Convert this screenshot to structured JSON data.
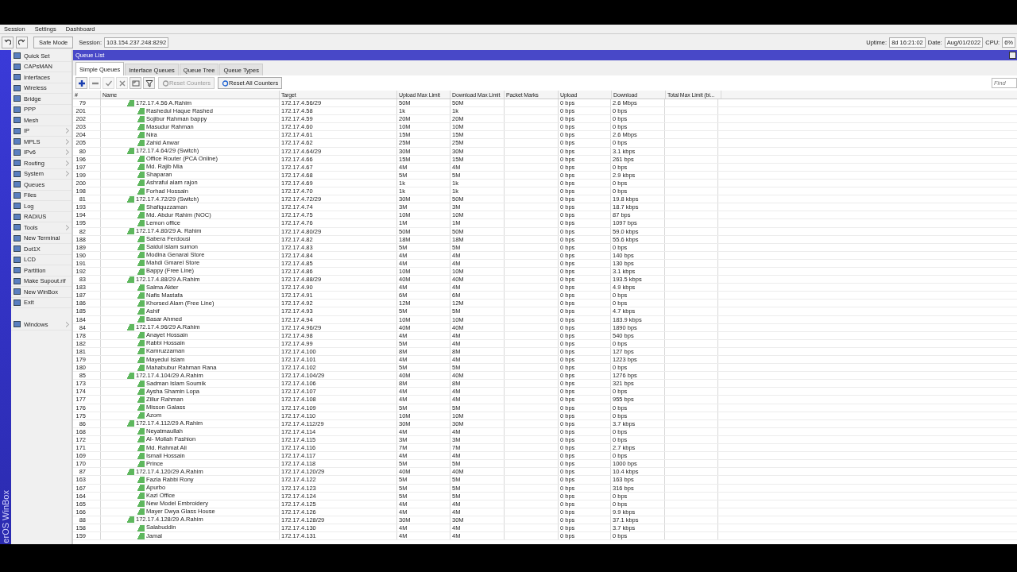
{
  "menu": [
    "Session",
    "Settings",
    "Dashboard"
  ],
  "toolbar": {
    "safe_mode": "Safe Mode",
    "session_label": "Session:",
    "session": "103.154.237.248:8292",
    "status": [
      {
        "label": "Uptime:",
        "value": "8d 16:21:02"
      },
      {
        "label": "Date:",
        "value": "Aug/01/2022"
      },
      {
        "label": "CPU:",
        "value": "6%"
      }
    ]
  },
  "brand": "erOS WinBox",
  "sidebar": {
    "items": [
      {
        "label": "Quick Set",
        "submenu": false
      },
      {
        "label": "CAPsMAN",
        "submenu": false
      },
      {
        "label": "Interfaces",
        "submenu": false
      },
      {
        "label": "Wireless",
        "submenu": false
      },
      {
        "label": "Bridge",
        "submenu": false
      },
      {
        "label": "PPP",
        "submenu": false
      },
      {
        "label": "Mesh",
        "submenu": false
      },
      {
        "label": "IP",
        "submenu": true
      },
      {
        "label": "MPLS",
        "submenu": true
      },
      {
        "label": "IPv6",
        "submenu": true
      },
      {
        "label": "Routing",
        "submenu": true
      },
      {
        "label": "System",
        "submenu": true
      },
      {
        "label": "Queues",
        "submenu": false
      },
      {
        "label": "Files",
        "submenu": false
      },
      {
        "label": "Log",
        "submenu": false
      },
      {
        "label": "RADIUS",
        "submenu": false
      },
      {
        "label": "Tools",
        "submenu": true
      },
      {
        "label": "New Terminal",
        "submenu": false
      },
      {
        "label": "Dot1X",
        "submenu": false
      },
      {
        "label": "LCD",
        "submenu": false
      },
      {
        "label": "Partition",
        "submenu": false
      },
      {
        "label": "Make Supout.rif",
        "submenu": false
      },
      {
        "label": "New WinBox",
        "submenu": false
      },
      {
        "label": "Exit",
        "submenu": false
      }
    ],
    "bottom_items": [
      {
        "label": "Windows",
        "submenu": true
      }
    ]
  },
  "window": {
    "title": "Queue List",
    "tabs": [
      {
        "label": "Simple Queues",
        "selected": true
      },
      {
        "label": "Interface Queues",
        "selected": false
      },
      {
        "label": "Queue Tree",
        "selected": false
      },
      {
        "label": "Queue Types",
        "selected": false
      }
    ],
    "tools": [
      {
        "kind": "add",
        "disabled": false
      },
      {
        "kind": "remove",
        "disabled": true
      },
      {
        "kind": "enable",
        "disabled": true
      },
      {
        "kind": "disable",
        "disabled": true
      },
      {
        "kind": "comment",
        "disabled": false
      },
      {
        "kind": "filter",
        "disabled": false
      }
    ],
    "actions": [
      {
        "label": "Reset Counters",
        "disabled": true
      },
      {
        "label": "Reset All Counters",
        "disabled": false
      }
    ],
    "search": {
      "placeholder": "Find"
    },
    "table": {
      "columns": [
        "#",
        "Name",
        "Target",
        "Upload Max Limit",
        "Download Max Limit",
        "Packet Marks",
        "Upload",
        "Download",
        "Total Max Limit (bi..."
      ],
      "rows": [
        {
          "number": "79",
          "name": "172.17.4.56 A.Rahim",
          "target": "172.17.4.56/29",
          "upload_max_limit": "50M",
          "download_max_limit": "50M",
          "upload": "0 bps",
          "download": "2.6 Mbps",
          "children": [
            {
              "number": "201",
              "name": "Rashedul Haque Rashed",
              "target": "172.17.4.58",
              "upload_max_limit": "1k",
              "download_max_limit": "1k",
              "upload": "0 bps",
              "download": "0 bps"
            },
            {
              "number": "202",
              "name": "Sojibur Rahman bappy",
              "target": "172.17.4.59",
              "upload_max_limit": "20M",
              "download_max_limit": "20M",
              "upload": "0 bps",
              "download": "0 bps"
            },
            {
              "number": "203",
              "name": "Masudur Rahman",
              "target": "172.17.4.60",
              "upload_max_limit": "10M",
              "download_max_limit": "10M",
              "upload": "0 bps",
              "download": "0 bps"
            },
            {
              "number": "204",
              "name": "Nira",
              "target": "172.17.4.61",
              "upload_max_limit": "15M",
              "download_max_limit": "15M",
              "upload": "0 bps",
              "download": "2.6 Mbps"
            },
            {
              "number": "205",
              "name": "Zahid Anwar",
              "target": "172.17.4.62",
              "upload_max_limit": "25M",
              "download_max_limit": "25M",
              "upload": "0 bps",
              "download": "0 bps"
            }
          ]
        },
        {
          "number": "80",
          "name": "172.17.4.64/29 (Switch)",
          "target": "172.17.4.64/29",
          "upload_max_limit": "30M",
          "download_max_limit": "30M",
          "upload": "0 bps",
          "download": "3.1 kbps",
          "children": [
            {
              "number": "196",
              "name": "Office Router (PCA Online)",
              "target": "172.17.4.66",
              "upload_max_limit": "15M",
              "download_max_limit": "15M",
              "upload": "0 bps",
              "download": "261 bps"
            },
            {
              "number": "197",
              "name": "Md. Rajib Mia",
              "target": "172.17.4.67",
              "upload_max_limit": "4M",
              "download_max_limit": "4M",
              "upload": "0 bps",
              "download": "0 bps"
            },
            {
              "number": "199",
              "name": "Shaparan",
              "target": "172.17.4.68",
              "upload_max_limit": "5M",
              "download_max_limit": "5M",
              "upload": "0 bps",
              "download": "2.9 kbps"
            },
            {
              "number": "200",
              "name": "Ashraful alam rajon",
              "target": "172.17.4.69",
              "upload_max_limit": "1k",
              "download_max_limit": "1k",
              "upload": "0 bps",
              "download": "0 bps"
            },
            {
              "number": "198",
              "name": "Forhad Hossain",
              "target": "172.17.4.70",
              "upload_max_limit": "1k",
              "download_max_limit": "1k",
              "upload": "0 bps",
              "download": "0 bps"
            }
          ]
        },
        {
          "number": "81",
          "name": "172.17.4.72/29 (Switch)",
          "target": "172.17.4.72/29",
          "upload_max_limit": "30M",
          "download_max_limit": "50M",
          "upload": "0 bps",
          "download": "19.8 kbps",
          "children": [
            {
              "number": "193",
              "name": "Shafiquzzaman",
              "target": "172.17.4.74",
              "upload_max_limit": "3M",
              "download_max_limit": "3M",
              "upload": "0 bps",
              "download": "18.7 kbps"
            },
            {
              "number": "194",
              "name": "Md. Abdur Rahim (NOC)",
              "target": "172.17.4.75",
              "upload_max_limit": "10M",
              "download_max_limit": "10M",
              "upload": "0 bps",
              "download": "87 bps"
            },
            {
              "number": "195",
              "name": "Lemon office",
              "target": "172.17.4.76",
              "upload_max_limit": "1M",
              "download_max_limit": "1M",
              "upload": "0 bps",
              "download": "1097 bps"
            }
          ]
        },
        {
          "number": "82",
          "name": "172.17.4.80/29 A. Rahim",
          "target": "172.17.4.80/29",
          "upload_max_limit": "50M",
          "download_max_limit": "50M",
          "upload": "0 bps",
          "download": "59.0 kbps",
          "children": [
            {
              "number": "188",
              "name": "Sabera Ferdousi",
              "target": "172.17.4.82",
              "upload_max_limit": "18M",
              "download_max_limit": "18M",
              "upload": "0 bps",
              "download": "55.6 kbps"
            },
            {
              "number": "189",
              "name": "Saidul islam sumon",
              "target": "172.17.4.83",
              "upload_max_limit": "5M",
              "download_max_limit": "5M",
              "upload": "0 bps",
              "download": "0 bps"
            },
            {
              "number": "190",
              "name": "Modina Genaral Store",
              "target": "172.17.4.84",
              "upload_max_limit": "4M",
              "download_max_limit": "4M",
              "upload": "0 bps",
              "download": "140 bps"
            },
            {
              "number": "191",
              "name": "Mahdi Gmarel Store",
              "target": "172.17.4.85",
              "upload_max_limit": "4M",
              "download_max_limit": "4M",
              "upload": "0 bps",
              "download": "130 bps"
            },
            {
              "number": "192",
              "name": "Bappy (Free Line)",
              "target": "172.17.4.86",
              "upload_max_limit": "10M",
              "download_max_limit": "10M",
              "upload": "0 bps",
              "download": "3.1 kbps"
            }
          ]
        },
        {
          "number": "83",
          "name": "172.17.4.88/29 A.Rahim",
          "target": "172.17.4.88/29",
          "upload_max_limit": "40M",
          "download_max_limit": "40M",
          "upload": "0 bps",
          "download": "193.5 kbps",
          "children": [
            {
              "number": "183",
              "name": "Salma Akter",
              "target": "172.17.4.90",
              "upload_max_limit": "4M",
              "download_max_limit": "4M",
              "upload": "0 bps",
              "download": "4.9 kbps"
            },
            {
              "number": "187",
              "name": "Nafis Mastafa",
              "target": "172.17.4.91",
              "upload_max_limit": "6M",
              "download_max_limit": "6M",
              "upload": "0 bps",
              "download": "0 bps"
            },
            {
              "number": "186",
              "name": "Khorsed Alam (Free Line)",
              "target": "172.17.4.92",
              "upload_max_limit": "12M",
              "download_max_limit": "12M",
              "upload": "0 bps",
              "download": "0 bps"
            },
            {
              "number": "185",
              "name": "Ashif",
              "target": "172.17.4.93",
              "upload_max_limit": "5M",
              "download_max_limit": "5M",
              "upload": "0 bps",
              "download": "4.7 kbps"
            },
            {
              "number": "184",
              "name": "Basar Ahmed",
              "target": "172.17.4.94",
              "upload_max_limit": "10M",
              "download_max_limit": "10M",
              "upload": "0 bps",
              "download": "183.9 kbps"
            }
          ]
        },
        {
          "number": "84",
          "name": "172.17.4.96/29 A.Rahim",
          "target": "172.17.4.96/29",
          "upload_max_limit": "40M",
          "download_max_limit": "40M",
          "upload": "0 bps",
          "download": "1890 bps",
          "children": [
            {
              "number": "178",
              "name": "Anayet Hossain",
              "target": "172.17.4.98",
              "upload_max_limit": "4M",
              "download_max_limit": "4M",
              "upload": "0 bps",
              "download": "540 bps"
            },
            {
              "number": "182",
              "name": "Rabbi Hossain",
              "target": "172.17.4.99",
              "upload_max_limit": "5M",
              "download_max_limit": "4M",
              "upload": "0 bps",
              "download": "0 bps"
            },
            {
              "number": "181",
              "name": "Kamruzzaman",
              "target": "172.17.4.100",
              "upload_max_limit": "8M",
              "download_max_limit": "8M",
              "upload": "0 bps",
              "download": "127 bps"
            },
            {
              "number": "179",
              "name": "Mayedul Islam",
              "target": "172.17.4.101",
              "upload_max_limit": "4M",
              "download_max_limit": "4M",
              "upload": "0 bps",
              "download": "1223 bps"
            },
            {
              "number": "180",
              "name": "Mahabubur Rahman Rana",
              "target": "172.17.4.102",
              "upload_max_limit": "5M",
              "download_max_limit": "5M",
              "upload": "0 bps",
              "download": "0 bps"
            }
          ]
        },
        {
          "number": "85",
          "name": "172.17.4.104/29 A.Rahim",
          "target": "172.17.4.104/29",
          "upload_max_limit": "40M",
          "download_max_limit": "40M",
          "upload": "0 bps",
          "download": "1276 bps",
          "children": [
            {
              "number": "173",
              "name": "Sadman Islam Soumik",
              "target": "172.17.4.106",
              "upload_max_limit": "8M",
              "download_max_limit": "8M",
              "upload": "0 bps",
              "download": "321 bps"
            },
            {
              "number": "174",
              "name": "Aysha Shamin Lopa",
              "target": "172.17.4.107",
              "upload_max_limit": "4M",
              "download_max_limit": "4M",
              "upload": "0 bps",
              "download": "0 bps"
            },
            {
              "number": "177",
              "name": "Zillur Rahman",
              "target": "172.17.4.108",
              "upload_max_limit": "4M",
              "download_max_limit": "4M",
              "upload": "0 bps",
              "download": "955 bps"
            },
            {
              "number": "176",
              "name": "Misson Galass",
              "target": "172.17.4.109",
              "upload_max_limit": "5M",
              "download_max_limit": "5M",
              "upload": "0 bps",
              "download": "0 bps"
            },
            {
              "number": "175",
              "name": "Azom",
              "target": "172.17.4.110",
              "upload_max_limit": "10M",
              "download_max_limit": "10M",
              "upload": "0 bps",
              "download": "0 bps"
            }
          ]
        },
        {
          "number": "86",
          "name": "172.17.4.112/29 A.Rahim",
          "target": "172.17.4.112/29",
          "upload_max_limit": "30M",
          "download_max_limit": "30M",
          "upload": "0 bps",
          "download": "3.7 kbps",
          "children": [
            {
              "number": "168",
              "name": "Neyatmaullah",
              "target": "172.17.4.114",
              "upload_max_limit": "4M",
              "download_max_limit": "4M",
              "upload": "0 bps",
              "download": "0 bps"
            },
            {
              "number": "172",
              "name": "Al- Mollah Fashion",
              "target": "172.17.4.115",
              "upload_max_limit": "3M",
              "download_max_limit": "3M",
              "upload": "0 bps",
              "download": "0 bps"
            },
            {
              "number": "171",
              "name": "Md. Rahmat Ali",
              "target": "172.17.4.116",
              "upload_max_limit": "7M",
              "download_max_limit": "7M",
              "upload": "0 bps",
              "download": "2.7 kbps"
            },
            {
              "number": "169",
              "name": "Ismail Hossain",
              "target": "172.17.4.117",
              "upload_max_limit": "4M",
              "download_max_limit": "4M",
              "upload": "0 bps",
              "download": "0 bps"
            },
            {
              "number": "170",
              "name": "Prince",
              "target": "172.17.4.118",
              "upload_max_limit": "5M",
              "download_max_limit": "5M",
              "upload": "0 bps",
              "download": "1000 bps"
            }
          ]
        },
        {
          "number": "87",
          "name": "172.17.4.120/29 A.Rahim",
          "target": "172.17.4.120/29",
          "upload_max_limit": "40M",
          "download_max_limit": "40M",
          "upload": "0 bps",
          "download": "10.4 kbps",
          "children": [
            {
              "number": "163",
              "name": "Fazla Rabbi Rony",
              "target": "172.17.4.122",
              "upload_max_limit": "5M",
              "download_max_limit": "5M",
              "upload": "0 bps",
              "download": "163 bps"
            },
            {
              "number": "167",
              "name": "Apurbo",
              "target": "172.17.4.123",
              "upload_max_limit": "5M",
              "download_max_limit": "5M",
              "upload": "0 bps",
              "download": "316 bps"
            },
            {
              "number": "164",
              "name": "Kazi Office",
              "target": "172.17.4.124",
              "upload_max_limit": "5M",
              "download_max_limit": "5M",
              "upload": "0 bps",
              "download": "0 bps"
            },
            {
              "number": "165",
              "name": "New Model Embroidery",
              "target": "172.17.4.125",
              "upload_max_limit": "4M",
              "download_max_limit": "4M",
              "upload": "0 bps",
              "download": "0 bps"
            },
            {
              "number": "166",
              "name": "Mayer Dwya Glass House",
              "target": "172.17.4.126",
              "upload_max_limit": "4M",
              "download_max_limit": "4M",
              "upload": "0 bps",
              "download": "9.9 kbps"
            }
          ]
        },
        {
          "number": "88",
          "name": "172.17.4.128/29 A.Rahim",
          "target": "172.17.4.128/29",
          "upload_max_limit": "30M",
          "download_max_limit": "30M",
          "upload": "0 bps",
          "download": "37.1 kbps",
          "children": [
            {
              "number": "158",
              "name": "Salabuddin",
              "target": "172.17.4.130",
              "upload_max_limit": "4M",
              "download_max_limit": "4M",
              "upload": "0 bps",
              "download": "3.7 kbps"
            },
            {
              "number": "159",
              "name": "Jamal",
              "target": "172.17.4.131",
              "upload_max_limit": "4M",
              "download_max_limit": "4M",
              "upload": "0 bps",
              "download": "0 bps"
            }
          ]
        }
      ]
    }
  }
}
